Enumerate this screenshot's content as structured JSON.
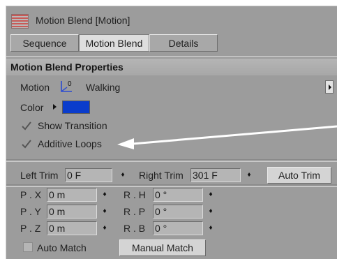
{
  "window": {
    "title": "Motion Blend [Motion]"
  },
  "tabs": [
    {
      "label": "Sequence"
    },
    {
      "label": "Motion Blend"
    },
    {
      "label": "Details"
    }
  ],
  "section": {
    "title": "Motion Blend Properties"
  },
  "motion": {
    "label": "Motion",
    "value": "Walking",
    "icon": "axis-motion-icon"
  },
  "color": {
    "label": "Color",
    "value": "#0a3ccc"
  },
  "checkboxes": {
    "show_transition": {
      "label": "Show Transition",
      "checked": true
    },
    "additive_loops": {
      "label": "Additive Loops",
      "checked": true
    }
  },
  "trim": {
    "left_label": "Left Trim",
    "left_value": "0 F",
    "right_label": "Right Trim",
    "right_value": "301 F",
    "auto_button": "Auto Trim"
  },
  "position": [
    {
      "label": "P . X",
      "value": "0 m"
    },
    {
      "label": "P . Y",
      "value": "0 m"
    },
    {
      "label": "P . Z",
      "value": "0 m"
    }
  ],
  "rotation": [
    {
      "label": "R . H",
      "value": "0 °"
    },
    {
      "label": "R . P",
      "value": "0 °"
    },
    {
      "label": "R . B",
      "value": "0 °"
    }
  ],
  "match": {
    "auto_label": "Auto Match",
    "auto_checked": false,
    "manual_button": "Manual Match"
  },
  "spinner_glyph": "♦"
}
